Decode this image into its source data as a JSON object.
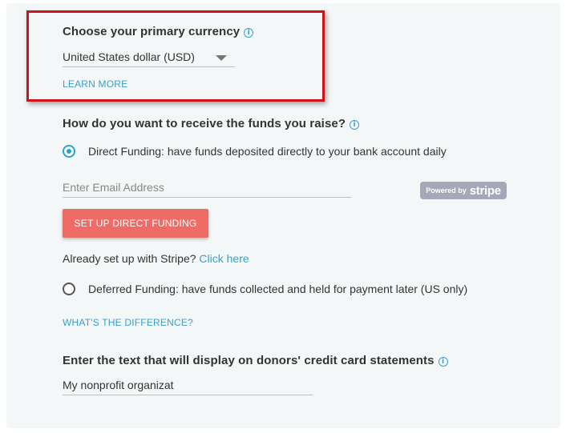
{
  "currency": {
    "heading": "Choose your primary currency",
    "info_icon": "i",
    "selected": "United States dollar (USD)",
    "learn_more": "LEARN MORE"
  },
  "funds": {
    "heading": "How do you want to receive the funds you raise?",
    "info_icon": "i",
    "direct_label": "Direct Funding: have funds deposited directly to your bank account daily",
    "direct_selected": true,
    "email_placeholder": "Enter Email Address",
    "email_value": "",
    "stripe_badge_small": "Powered by",
    "stripe_badge_word": "stripe",
    "setup_button": "SET UP DIRECT FUNDING",
    "already_text": "Already set up with Stripe?",
    "click_here": "Click here",
    "deferred_label": "Deferred Funding: have funds collected and held for payment later (US only)",
    "deferred_selected": false,
    "whats_difference": "WHAT'S THE DIFFERENCE?"
  },
  "statement": {
    "heading": "Enter the text that will display on donors' credit card statements",
    "info_icon": "i",
    "value": "My nonprofit organizat"
  },
  "colors": {
    "accent": "#3a9fc9",
    "button": "#ef6c66",
    "highlight_border": "#d0121b"
  }
}
